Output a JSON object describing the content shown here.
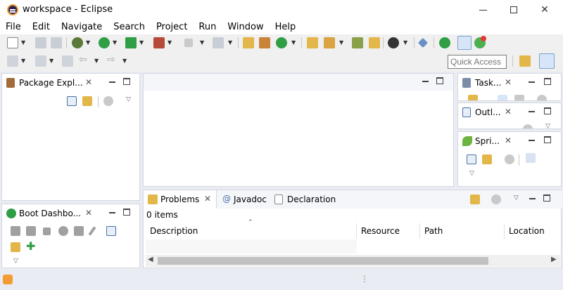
{
  "window": {
    "title": "workspace - Eclipse"
  },
  "menu": [
    "File",
    "Edit",
    "Navigate",
    "Search",
    "Project",
    "Run",
    "Window",
    "Help"
  ],
  "quick_access": {
    "placeholder": "Quick Access"
  },
  "package_explorer": {
    "title": "Package Expl..."
  },
  "boot_dashboard": {
    "title": "Boot Dashbo..."
  },
  "tasks": {
    "title": "Task..."
  },
  "outline": {
    "title": "Outl..."
  },
  "spring": {
    "title": "Spri..."
  },
  "bottom_tabs": [
    "Problems",
    "Javadoc",
    "Declaration"
  ],
  "problems": {
    "count": "0 items",
    "columns": [
      "Description",
      "Resource",
      "Path",
      "Location"
    ]
  },
  "colors": {
    "accent": "#3c78d8",
    "run_green": "#2f9e44",
    "spring_green": "#6db33f",
    "rss_orange": "#f39c34"
  }
}
